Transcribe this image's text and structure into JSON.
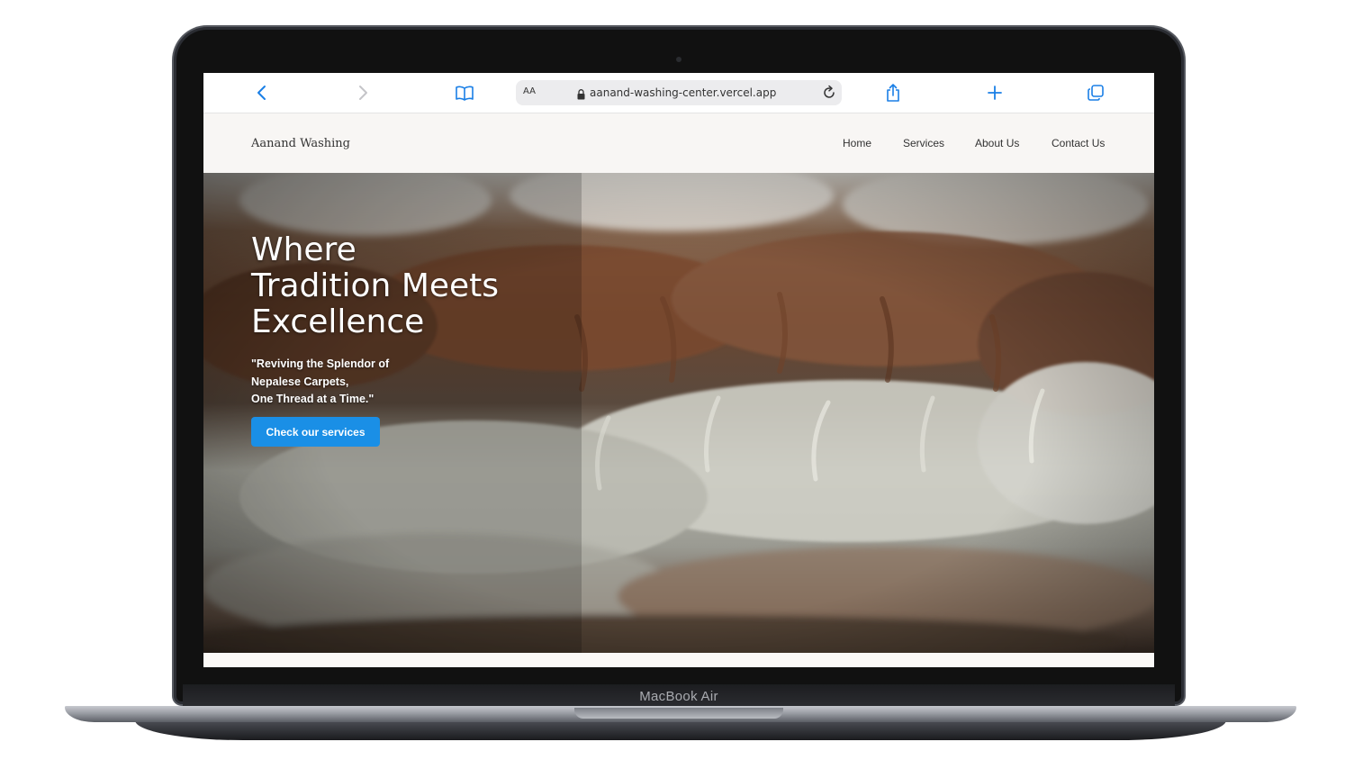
{
  "device": {
    "label": "MacBook Air"
  },
  "browser": {
    "address_prefix": "AA",
    "url": "aanand-washing-center.vercel.app",
    "icons": {
      "back": "chevron-left-icon",
      "forward": "chevron-right-icon",
      "bookmarks": "book-icon",
      "lock": "lock-icon",
      "reload": "reload-icon",
      "share": "share-icon",
      "new_tab": "plus-icon",
      "tabs": "tabs-icon"
    },
    "accent_color": "#1a7fe6"
  },
  "site": {
    "brand": "Aanand Washing",
    "nav": {
      "home": "Home",
      "services": "Services",
      "about": "About Us",
      "contact": "Contact Us"
    },
    "hero": {
      "title_lines": [
        "Where",
        "Tradition Meets",
        "Excellence"
      ],
      "subtitle_lines": [
        "\"Reviving the Splendor of",
        "Nepalese Carpets,",
        "One Thread at a Time.\""
      ],
      "cta_label": "Check our services",
      "cta_color": "#1a8fe6"
    }
  }
}
